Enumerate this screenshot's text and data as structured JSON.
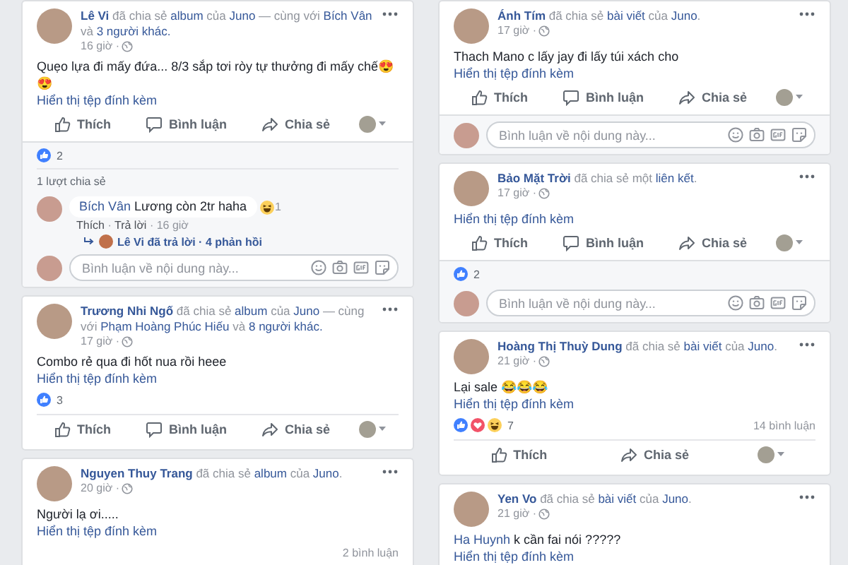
{
  "columns": [
    {
      "posts": [
        {
          "header": [
            {
              "text": "Lê Vi",
              "kind": "name"
            },
            {
              "text": " đã chia sẻ ",
              "kind": "plain"
            },
            {
              "text": "album",
              "kind": "link"
            },
            {
              "text": " của ",
              "kind": "plain"
            },
            {
              "text": "Juno",
              "kind": "link"
            },
            {
              "text": " — cùng với ",
              "kind": "plain"
            },
            {
              "text": "Bích Vân",
              "kind": "link"
            },
            {
              "text": " và ",
              "kind": "plain"
            },
            {
              "text": "3 người khác.",
              "kind": "link"
            }
          ],
          "time": "16 giờ ·",
          "body": [
            {
              "text": "Quẹo lựa đi mấy đứa... 8/3 sắp tơi ròy tự thưởng đi mấy chế😍😍",
              "kind": "plain"
            }
          ],
          "attachment_link": "Hiển thị tệp đính kèm",
          "sections": [
            {
              "kind": "actions",
              "buttons": [
                {
                  "label": "Thích",
                  "kind": "like"
                },
                {
                  "label": "Bình luận",
                  "kind": "comment"
                },
                {
                  "label": "Chia sẻ",
                  "kind": "share"
                }
              ]
            },
            {
              "kind": "stats",
              "reactions": [
                {
                  "kind": "like"
                }
              ],
              "count": "2"
            },
            {
              "kind": "shares",
              "text": "1 lượt chia sẻ"
            },
            {
              "kind": "comment",
              "author": "Bích Vân",
              "text": "Lương còn 2tr haha",
              "reaction": {
                "kind": "haha",
                "count": "1"
              },
              "meta": [
                {
                  "text": "Thích",
                  "kind": "link"
                },
                {
                  "text": " · ",
                  "kind": "plain"
                },
                {
                  "text": "Trả lời",
                  "kind": "link"
                },
                {
                  "text": " · 16 giờ",
                  "kind": "plain"
                }
              ],
              "reply_summary": "Lê Vi đã trả lời · 4 phản hồi"
            },
            {
              "kind": "comment_input",
              "placeholder": "Bình luận về nội dung này..."
            }
          ]
        },
        {
          "header": [
            {
              "text": "Trương Nhi Ngố",
              "kind": "name"
            },
            {
              "text": " đã chia sẻ ",
              "kind": "plain"
            },
            {
              "text": "album",
              "kind": "link"
            },
            {
              "text": " của ",
              "kind": "plain"
            },
            {
              "text": "Juno",
              "kind": "link"
            },
            {
              "text": " — cùng với ",
              "kind": "plain"
            },
            {
              "text": "Phạm Hoàng Phúc Hiếu",
              "kind": "link"
            },
            {
              "text": " và ",
              "kind": "plain"
            },
            {
              "text": "8 người khác.",
              "kind": "link"
            }
          ],
          "time": "17 giờ ·",
          "body": [
            {
              "text": "Combo rẻ qua đi hốt nua rồi heee",
              "kind": "plain"
            }
          ],
          "attachment_link": "Hiển thị tệp đính kèm",
          "sections": [
            {
              "kind": "stats",
              "reactions": [
                {
                  "kind": "like"
                }
              ],
              "count": "3"
            },
            {
              "kind": "actions",
              "buttons": [
                {
                  "label": "Thích",
                  "kind": "like"
                },
                {
                  "label": "Bình luận",
                  "kind": "comment"
                },
                {
                  "label": "Chia sẻ",
                  "kind": "share"
                }
              ]
            }
          ]
        },
        {
          "header": [
            {
              "text": "Nguyen Thuy Trang",
              "kind": "name"
            },
            {
              "text": " đã chia sẻ ",
              "kind": "plain"
            },
            {
              "text": "album",
              "kind": "link"
            },
            {
              "text": " của ",
              "kind": "plain"
            },
            {
              "text": "Juno",
              "kind": "link"
            },
            {
              "text": ".",
              "kind": "plain"
            }
          ],
          "time": "20 giờ ·",
          "body": [
            {
              "text": "Người lạ ơi.....",
              "kind": "plain"
            }
          ],
          "attachment_link": "Hiển thị tệp đính kèm",
          "sections": [
            {
              "kind": "stats",
              "comment_count": "2 bình luận"
            }
          ]
        }
      ]
    },
    {
      "posts": [
        {
          "header": [
            {
              "text": "Ánh Tím",
              "kind": "name"
            },
            {
              "text": " đã chia sẻ ",
              "kind": "plain"
            },
            {
              "text": "bài viết",
              "kind": "link"
            },
            {
              "text": " của ",
              "kind": "plain"
            },
            {
              "text": "Juno",
              "kind": "link"
            },
            {
              "text": ".",
              "kind": "plain"
            }
          ],
          "time": "17 giờ ·",
          "body": [
            {
              "text": "Thach Mano c lấy jay đi lấy túi xách cho",
              "kind": "plain"
            }
          ],
          "attachment_link": "Hiển thị tệp đính kèm",
          "sections": [
            {
              "kind": "actions",
              "buttons": [
                {
                  "label": "Thích",
                  "kind": "like"
                },
                {
                  "label": "Bình luận",
                  "kind": "comment"
                },
                {
                  "label": "Chia sẻ",
                  "kind": "share"
                }
              ]
            },
            {
              "kind": "comment_input",
              "placeholder": "Bình luận về nội dung này..."
            }
          ]
        },
        {
          "header": [
            {
              "text": "Bảo Mặt Trời",
              "kind": "name"
            },
            {
              "text": " đã chia sẻ một ",
              "kind": "plain"
            },
            {
              "text": "liên kết",
              "kind": "link"
            },
            {
              "text": ".",
              "kind": "plain"
            }
          ],
          "time": "17 giờ ·",
          "attachment_link": "Hiển thị tệp đính kèm",
          "sections": [
            {
              "kind": "actions",
              "buttons": [
                {
                  "label": "Thích",
                  "kind": "like"
                },
                {
                  "label": "Bình luận",
                  "kind": "comment"
                },
                {
                  "label": "Chia sẻ",
                  "kind": "share"
                }
              ]
            },
            {
              "kind": "stats",
              "reactions": [
                {
                  "kind": "like"
                }
              ],
              "count": "2"
            },
            {
              "kind": "comment_input",
              "placeholder": "Bình luận về nội dung này..."
            }
          ]
        },
        {
          "header": [
            {
              "text": "Hoàng Thị Thuỳ Dung",
              "kind": "name"
            },
            {
              "text": " đã chia sẻ ",
              "kind": "plain"
            },
            {
              "text": "bài viết",
              "kind": "link"
            },
            {
              "text": " của ",
              "kind": "plain"
            },
            {
              "text": "Juno",
              "kind": "link"
            },
            {
              "text": ".",
              "kind": "plain"
            }
          ],
          "time": "21 giờ ·",
          "body": [
            {
              "text": "Lại sale 😂😂😂",
              "kind": "plain"
            }
          ],
          "attachment_link": "Hiển thị tệp đính kèm",
          "sections": [
            {
              "kind": "stats",
              "reactions": [
                {
                  "kind": "like"
                },
                {
                  "kind": "love"
                },
                {
                  "kind": "haha"
                }
              ],
              "count": "7",
              "comment_count": "14 bình luận"
            },
            {
              "kind": "actions",
              "buttons": [
                {
                  "label": "Thích",
                  "kind": "like"
                },
                {
                  "label": "Chia sẻ",
                  "kind": "share"
                }
              ]
            }
          ]
        },
        {
          "header": [
            {
              "text": "Yen Vo",
              "kind": "name"
            },
            {
              "text": " đã chia sẻ ",
              "kind": "plain"
            },
            {
              "text": "bài viết",
              "kind": "link"
            },
            {
              "text": " của ",
              "kind": "plain"
            },
            {
              "text": "Juno",
              "kind": "link"
            },
            {
              "text": ".",
              "kind": "plain"
            }
          ],
          "time": "21 giờ ·",
          "body": [
            {
              "text": "Ha Huynh",
              "kind": "link"
            },
            {
              "text": " k cần fai nói ?????",
              "kind": "plain"
            }
          ],
          "attachment_link": "Hiển thị tệp đính kèm"
        }
      ]
    }
  ]
}
